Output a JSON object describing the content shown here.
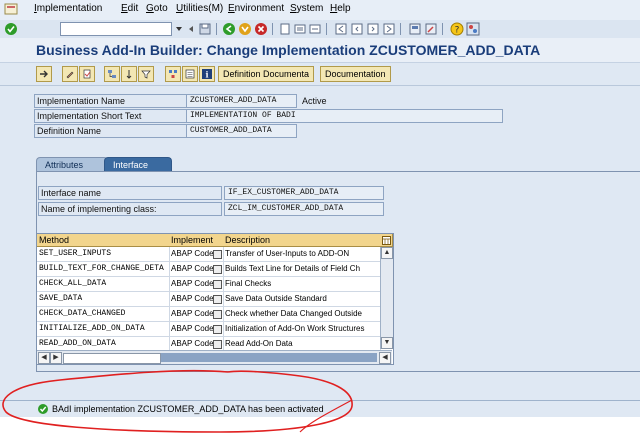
{
  "menu": [
    "Implementation",
    "Edit",
    "Goto",
    "Utilities(M)",
    "Environment",
    "System",
    "Help"
  ],
  "title": "Business Add-In Builder: Change Implementation ZCUSTOMER_ADD_DATA",
  "app_toolbar": {
    "definition_button": "Definition Documenta",
    "documentation_button": "Documentation"
  },
  "header_fields": {
    "impl_name_label": "Implementation Name",
    "impl_name_value": "ZCUSTOMER_ADD_DATA",
    "impl_status": "Active",
    "short_text_label": "Implementation Short Text",
    "short_text_value": "IMPLEMENTATION OF BADI",
    "def_name_label": "Definition Name",
    "def_name_value": "CUSTOMER_ADD_DATA"
  },
  "tabs": [
    "Attributes",
    "Interface"
  ],
  "interface": {
    "name_label": "Interface name",
    "name_value": "IF_EX_CUSTOMER_ADD_DATA",
    "class_label": "Name of implementing class:",
    "class_value": "ZCL_IM_CUSTOMER_ADD_DATA"
  },
  "table": {
    "columns": [
      "Method",
      "Implement",
      "Description"
    ],
    "rows": [
      {
        "method": "SET_USER_INPUTS",
        "impl": "ABAP Code",
        "desc": "Transfer of User-Inputs to ADD-ON"
      },
      {
        "method": "BUILD_TEXT_FOR_CHANGE_DETA",
        "impl": "ABAP Code",
        "desc": "Builds Text Line for Details of Field Ch"
      },
      {
        "method": "CHECK_ALL_DATA",
        "impl": "ABAP Code",
        "desc": "Final Checks"
      },
      {
        "method": "SAVE_DATA",
        "impl": "ABAP Code",
        "desc": "Save Data Outside Standard"
      },
      {
        "method": "CHECK_DATA_CHANGED",
        "impl": "ABAP Code",
        "desc": "Check whether Data Changed Outside"
      },
      {
        "method": "INITIALIZE_ADD_ON_DATA",
        "impl": "ABAP Code",
        "desc": "Initialization of Add-On Work Structures"
      },
      {
        "method": "READ_ADD_ON_DATA",
        "impl": "ABAP Code",
        "desc": "Read Add-On Data"
      }
    ]
  },
  "status": {
    "message": "BAdI implementation ZCUSTOMER_ADD_DATA has been activated"
  },
  "colors": {
    "title": "#1a3d7a",
    "tab_active": "#3a6aa0",
    "table_header": "#f2d58d",
    "status_success": "#2e9c2a",
    "annotation": "#e02020"
  }
}
